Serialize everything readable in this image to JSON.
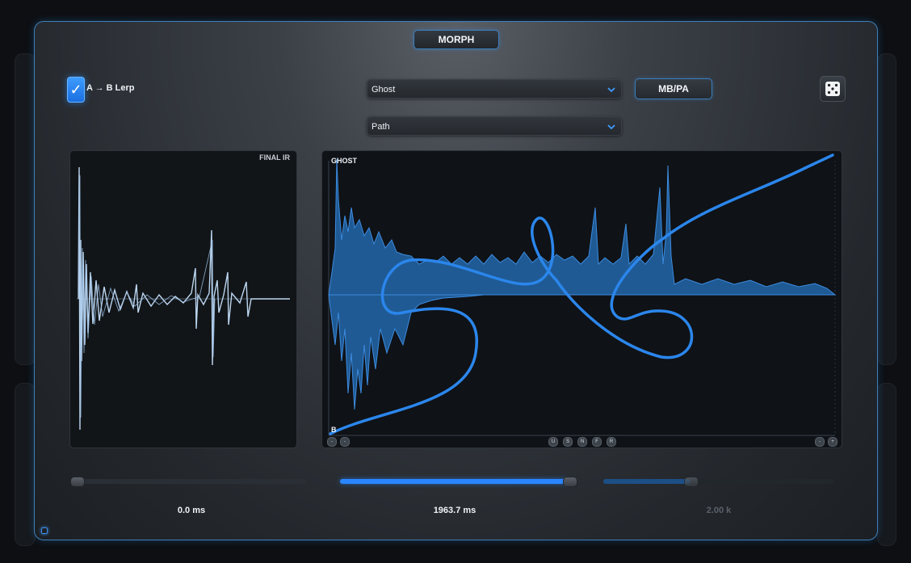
{
  "header": {
    "title": "MORPH"
  },
  "controls": {
    "lerp_checkbox": {
      "label": "A → B Lerp",
      "checked": true
    },
    "dropdown_1": {
      "value": "Ghost"
    },
    "dropdown_2": {
      "value": "Path"
    },
    "mbpa_button": "MB/PA",
    "dice_icon": "dice-icon"
  },
  "left_panel": {
    "tag": "FINAL IR"
  },
  "right_panel": {
    "tag_top": "GHOST",
    "tag_bottom": "B",
    "buttons_left": [
      "-",
      "-"
    ],
    "buttons_center": [
      "U",
      "S",
      "N",
      "F",
      "R"
    ],
    "buttons_right": [
      "-",
      "+"
    ]
  },
  "sliders": [
    {
      "value_label": "0.0 ms",
      "fraction": 0.0
    },
    {
      "value_label": "1963.7 ms",
      "fraction": 0.96
    },
    {
      "value_label": "2.00 k",
      "fraction": 0.38,
      "dimmed": true
    }
  ],
  "colors": {
    "accent": "#2a86ff",
    "waveform": "#bcd6f0",
    "ghost_fill": "#1f5a94",
    "path": "#2b86ec"
  }
}
